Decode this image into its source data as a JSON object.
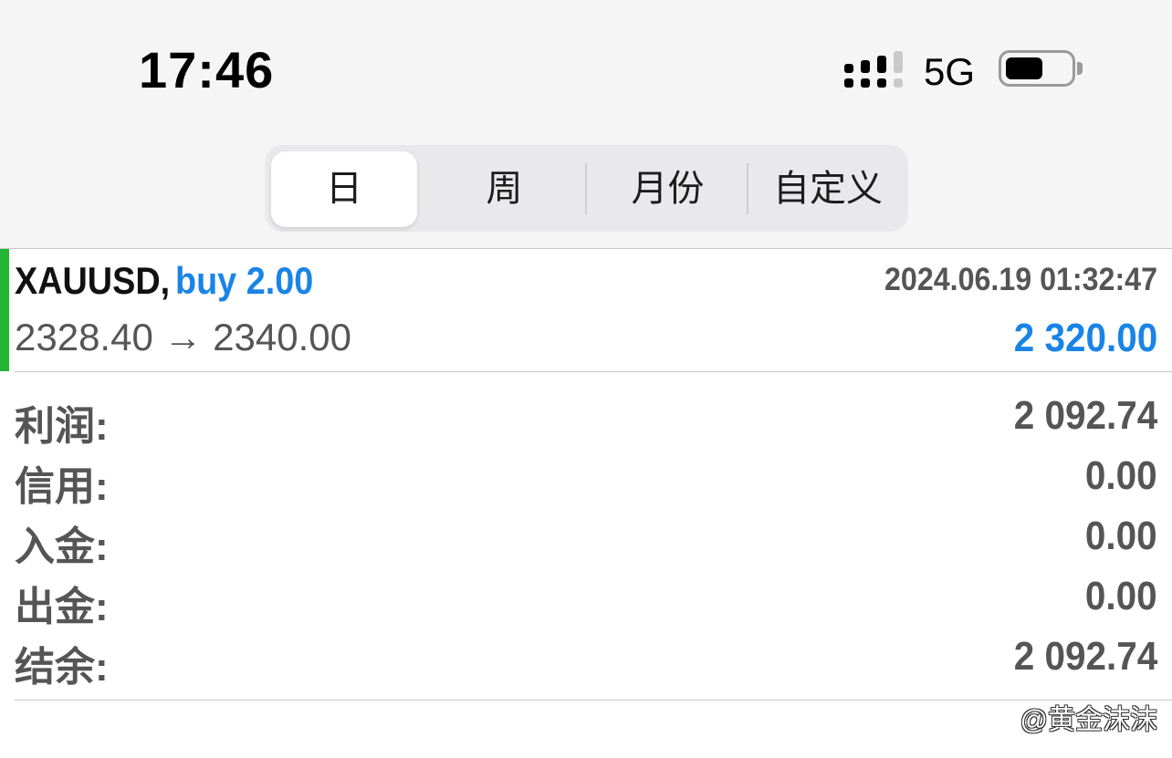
{
  "status_bar": {
    "time": "17:46",
    "network": "5G",
    "signal_icon": "signal-bars-icon",
    "battery_icon": "battery-icon"
  },
  "period_tabs": [
    {
      "label": "日",
      "selected": true
    },
    {
      "label": "周",
      "selected": false
    },
    {
      "label": "月份",
      "selected": false
    },
    {
      "label": "自定义",
      "selected": false
    }
  ],
  "trade": {
    "symbol": "XAUUSD,",
    "type_volume": "buy 2.00",
    "datetime": "2024.06.19 01:32:47",
    "price_range": "2328.40 → 2340.00",
    "profit": "2 320.00",
    "colors": {
      "accent": "#21b533",
      "highlight": "#1a84e6"
    }
  },
  "summary": [
    {
      "label": "利润:",
      "value": "2 092.74"
    },
    {
      "label": "信用:",
      "value": "0.00"
    },
    {
      "label": "入金:",
      "value": "0.00"
    },
    {
      "label": "出金:",
      "value": "0.00"
    },
    {
      "label": "结余:",
      "value": "2 092.74"
    }
  ],
  "watermark": "@黄金沫沫"
}
